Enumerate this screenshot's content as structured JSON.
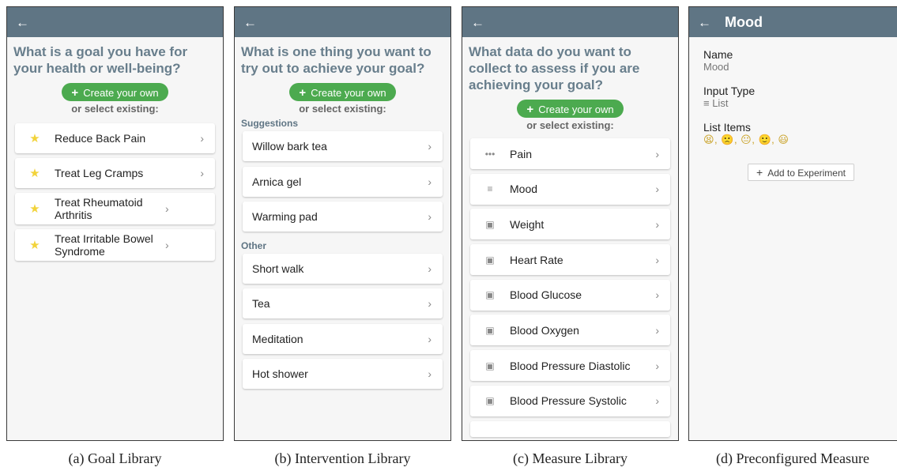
{
  "panel_a": {
    "question": "What is a goal you have for your health or well-being?",
    "create_label": "Create your own",
    "or_select": "or select existing:",
    "items": [
      {
        "label": "Reduce Back Pain"
      },
      {
        "label": "Treat Leg Cramps"
      },
      {
        "label": "Treat Rheumatoid Arthritis"
      },
      {
        "label": "Treat Irritable Bowel Syndrome"
      }
    ],
    "caption": "(a) Goal Library"
  },
  "panel_b": {
    "question": "What is one thing you want to try out to achieve your goal?",
    "create_label": "Create your own",
    "or_select": "or select existing:",
    "suggestions_label": "Suggestions",
    "suggestions": [
      {
        "label": "Willow bark tea"
      },
      {
        "label": "Arnica gel"
      },
      {
        "label": "Warming pad"
      }
    ],
    "other_label": "Other",
    "other": [
      {
        "label": "Short walk"
      },
      {
        "label": "Tea"
      },
      {
        "label": "Meditation"
      },
      {
        "label": "Hot shower"
      }
    ],
    "caption": "(b) Intervention Library"
  },
  "panel_c": {
    "question": "What data do you want to collect to assess if you are achieving your goal?",
    "create_label": "Create your own",
    "or_select": "or select existing:",
    "items": [
      {
        "label": "Pain",
        "icon": "dots-icon"
      },
      {
        "label": "Mood",
        "icon": "list-icon"
      },
      {
        "label": "Weight",
        "icon": "device-icon"
      },
      {
        "label": "Heart Rate",
        "icon": "device-icon"
      },
      {
        "label": "Blood Glucose",
        "icon": "device-icon"
      },
      {
        "label": "Blood Oxygen",
        "icon": "device-icon"
      },
      {
        "label": "Blood Pressure Diastolic",
        "icon": "device-icon"
      },
      {
        "label": "Blood Pressure Systolic",
        "icon": "device-icon"
      }
    ],
    "caption": "(c) Measure Library"
  },
  "panel_d": {
    "title": "Mood",
    "name_label": "Name",
    "name_value": "Mood",
    "input_type_label": "Input Type",
    "input_type_value": "List",
    "list_items_label": "List Items",
    "list_items_value": "😫, 🙁, 😐, 🙂, 😃",
    "add_label": "Add to Experiment",
    "caption": "(d) Preconfigured Measure"
  }
}
